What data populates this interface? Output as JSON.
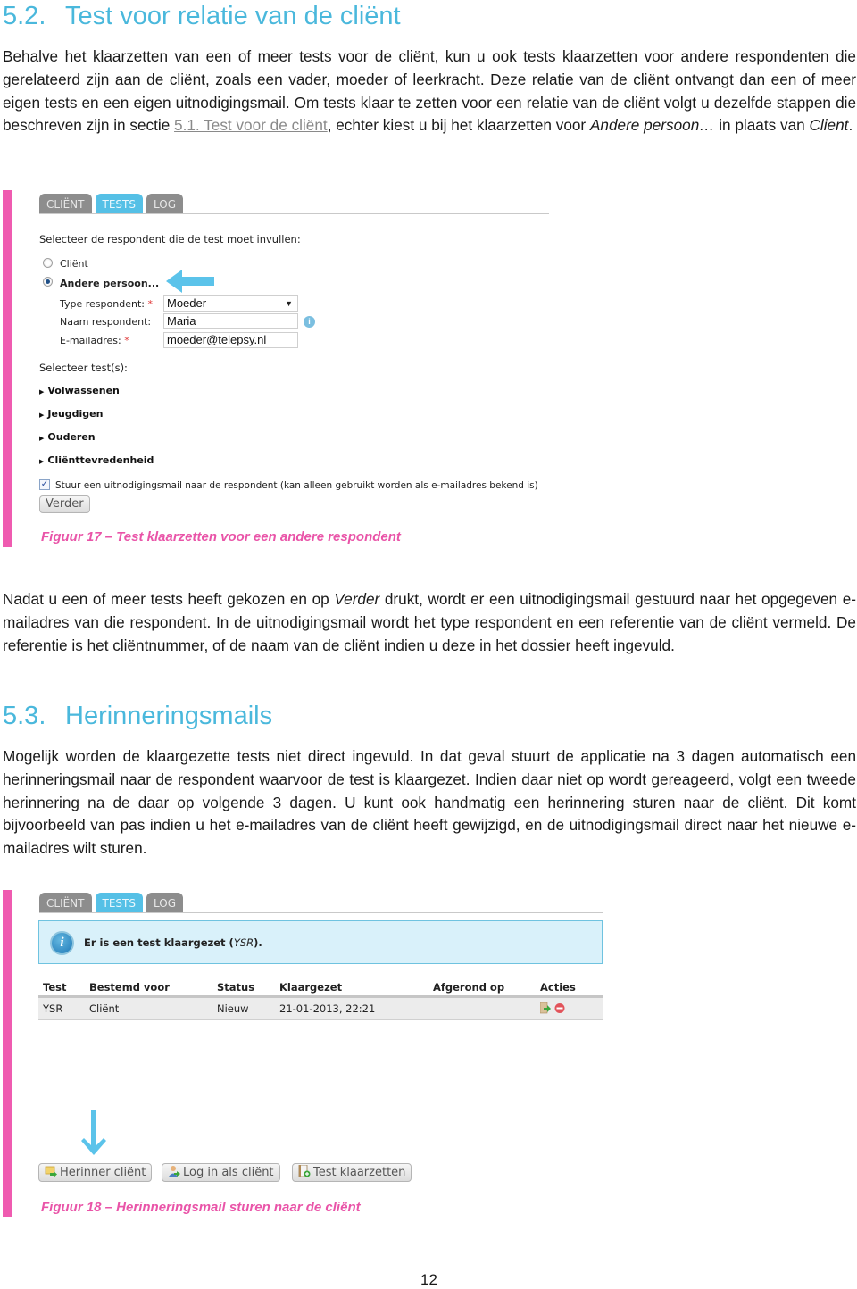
{
  "section_52": {
    "number": "5.2.",
    "title": "Test voor relatie van de cliënt",
    "paragraph": {
      "text_before_link": "Behalve het klaarzetten van een of meer tests voor de cliënt, kun u ook tests klaarzetten voor andere respondenten die gerelateerd zijn aan de cliënt, zoals een vader, moeder of leerkracht. Deze relatie van de cliënt ontvangt dan een of meer eigen tests en een eigen uitnodigingsmail. Om tests klaar te zetten voor een relatie van de cliënt volgt u dezelfde stappen die beschreven zijn in sectie ",
      "link": "5.1. Test voor de cliënt",
      "text_after_link": ", echter kiest u bij het klaarzetten voor ",
      "italic_1": "Andere persoon…",
      "text_middle": " in plaats van ",
      "italic_2": "Client",
      "text_end": "."
    }
  },
  "figure17": {
    "tabs": [
      "CLIËNT",
      "TESTS",
      "LOG"
    ],
    "active_tab": "TESTS",
    "respondent_prompt": "Selecteer de respondent die de test moet invullen:",
    "radio_options": [
      {
        "label": "Cliënt",
        "checked": false
      },
      {
        "label": "Andere persoon...",
        "checked": true
      }
    ],
    "fields": {
      "type_label": "Type respondent:",
      "type_value": "Moeder",
      "name_label": "Naam respondent:",
      "name_value": "Maria",
      "email_label": "E-mailadres:",
      "email_value": "moeder@telepsy.nl",
      "required_marker": "*"
    },
    "tests_prompt": "Selecteer test(s):",
    "test_groups": [
      "Volwassenen",
      "Jeugdigen",
      "Ouderen",
      "Cliënttevredenheid"
    ],
    "invite_checkbox": {
      "checked": true,
      "label": "Stuur een uitnodigingsmail naar de respondent (kan alleen gebruikt worden als e-mailadres bekend is)"
    },
    "next_button": "Verder",
    "caption": "Figuur 17 – Test klaarzetten voor een andere respondent"
  },
  "paragraph_after_17": {
    "text_1": "Nadat u een of meer tests heeft gekozen en op ",
    "italic": "Verder",
    "text_2": " drukt, wordt er een uitnodigingsmail gestuurd naar het opgegeven e-mailadres van die respondent. In de uitnodigingsmail wordt het type respondent en een referentie van de cliënt vermeld. De referentie is het cliëntnummer, of de naam van de cliënt indien u deze in het dossier heeft ingevuld."
  },
  "section_53": {
    "number": "5.3.",
    "title": "Herinneringsmails",
    "paragraph": "Mogelijk worden de klaargezette tests niet direct ingevuld. In dat geval stuurt de applicatie na 3 dagen automatisch een herinneringsmail naar de respondent waarvoor de test is klaargezet. Indien daar niet op wordt gereageerd, volgt een tweede herinnering na de daar op volgende 3 dagen. U kunt ook handmatig een herinnering sturen naar de cliënt. Dit komt bijvoorbeeld van pas indien u het e-mailadres van de cliënt heeft gewijzigd, en de uitnodigingsmail direct naar het nieuwe e-mailadres wilt sturen."
  },
  "figure18": {
    "tabs": [
      "CLIËNT",
      "TESTS",
      "LOG"
    ],
    "active_tab": "TESTS",
    "notice": {
      "text": "Er is een test klaargezet (",
      "italic": "YSR",
      "text_end": ")."
    },
    "table": {
      "headers": [
        "Test",
        "Bestemd voor",
        "Status",
        "Klaargezet",
        "Afgerond op",
        "Acties"
      ],
      "rows": [
        {
          "test": "YSR",
          "bestemd_voor": "Cliënt",
          "status": "Nieuw",
          "klaargezet": "21-01-2013, 22:21",
          "afgerond_op": "",
          "acties": [
            "start-test-icon",
            "delete-icon"
          ]
        }
      ]
    },
    "buttons": [
      {
        "label": "Herinner cliënt",
        "icon": "mail-forward-icon"
      },
      {
        "label": "Log in als cliënt",
        "icon": "user-login-icon"
      },
      {
        "label": "Test klaarzetten",
        "icon": "add-test-icon"
      }
    ],
    "caption": "Figuur 18 – Herinneringsmail sturen naar de cliënt"
  },
  "colors": {
    "heading": "#4ab8dc",
    "caption": "#e954a8",
    "figure_bar": "#ef5bb0",
    "active_tab": "#55c0e6",
    "inactive_tab": "#8d8d8d",
    "arrow": "#5bc3ea"
  },
  "page_number": "12"
}
